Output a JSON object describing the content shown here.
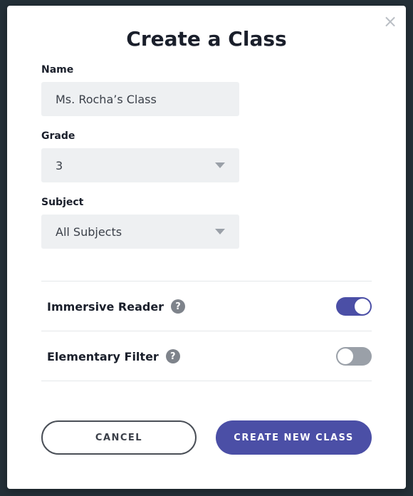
{
  "dialog": {
    "title": "Create a Class",
    "close_glyph": "×"
  },
  "form": {
    "name": {
      "label": "Name",
      "value": "Ms. Rocha’s Class"
    },
    "grade": {
      "label": "Grade",
      "value": "3"
    },
    "subject": {
      "label": "Subject",
      "value": "All Subjects"
    }
  },
  "toggles": {
    "immersive_reader": {
      "label": "Immersive Reader",
      "help": "?",
      "state": "on"
    },
    "elementary_filter": {
      "label": "Elementary Filter",
      "help": "?",
      "state": "off"
    }
  },
  "actions": {
    "cancel_label": "CANCEL",
    "create_label": "CREATE NEW CLASS"
  },
  "colors": {
    "accent": "#4b4fa6",
    "toggle_off": "#9aa0a8",
    "field_bg": "#eef0f2"
  },
  "icons": {
    "close": "close-icon",
    "help": "help-icon",
    "caret": "chevron-down-icon"
  }
}
